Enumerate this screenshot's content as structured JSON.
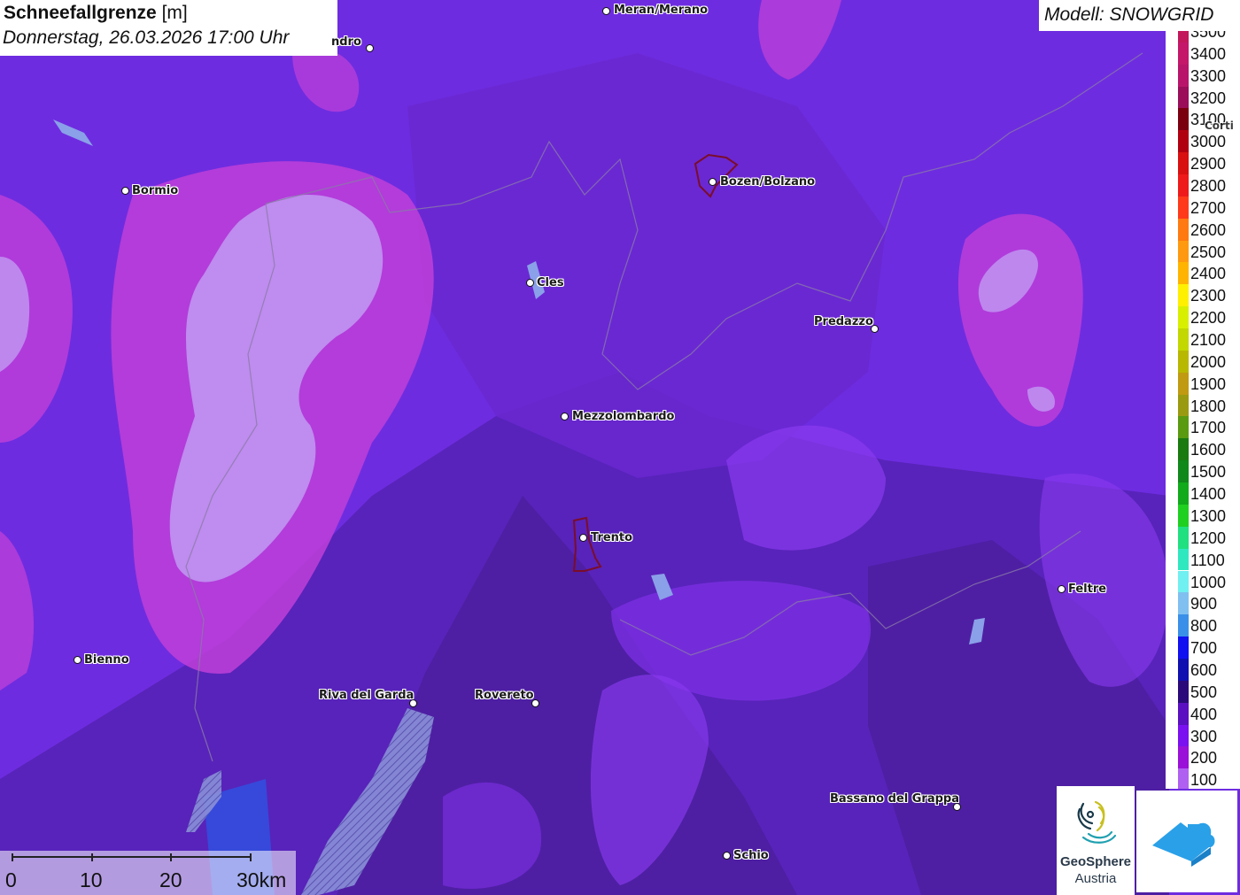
{
  "header": {
    "title_bold": "Schneefallgrenze",
    "title_unit": "[m]",
    "datetime": "Donnerstag, 26.03.2026 17:00 Uhr"
  },
  "model": {
    "label": "Modell: SNOWGRID"
  },
  "legend": {
    "items": [
      {
        "value": "3500",
        "color": "#c2185b"
      },
      {
        "value": "3400",
        "color": "#c4176a"
      },
      {
        "value": "3300",
        "color": "#b8156a"
      },
      {
        "value": "3200",
        "color": "#9a0e5a"
      },
      {
        "value": "3100",
        "color": "#7a0010"
      },
      {
        "value": "3000",
        "color": "#b00010"
      },
      {
        "value": "2900",
        "color": "#d81010"
      },
      {
        "value": "2800",
        "color": "#ee1a1a"
      },
      {
        "value": "2700",
        "color": "#ff3a1a"
      },
      {
        "value": "2600",
        "color": "#ff7a10"
      },
      {
        "value": "2500",
        "color": "#ff9a10"
      },
      {
        "value": "2400",
        "color": "#ffb400"
      },
      {
        "value": "2300",
        "color": "#fff000"
      },
      {
        "value": "2200",
        "color": "#d8f000"
      },
      {
        "value": "2100",
        "color": "#c2d800"
      },
      {
        "value": "2000",
        "color": "#b8b800"
      },
      {
        "value": "1900",
        "color": "#c09a10"
      },
      {
        "value": "1800",
        "color": "#9a9a10"
      },
      {
        "value": "1700",
        "color": "#5a9a10"
      },
      {
        "value": "1600",
        "color": "#1a7a10"
      },
      {
        "value": "1500",
        "color": "#10881a"
      },
      {
        "value": "1400",
        "color": "#10aa1a"
      },
      {
        "value": "1300",
        "color": "#20d020"
      },
      {
        "value": "1200",
        "color": "#20e080"
      },
      {
        "value": "1100",
        "color": "#30e8c0"
      },
      {
        "value": "1000",
        "color": "#70f0f0"
      },
      {
        "value": "900",
        "color": "#80c0f0"
      },
      {
        "value": "800",
        "color": "#3a90e8"
      },
      {
        "value": "700",
        "color": "#1010f0"
      },
      {
        "value": "600",
        "color": "#1010b0"
      },
      {
        "value": "500",
        "color": "#2a0a7a"
      },
      {
        "value": "400",
        "color": "#5a10c0"
      },
      {
        "value": "300",
        "color": "#7a10f0"
      },
      {
        "value": "200",
        "color": "#9a10d8"
      },
      {
        "value": "100",
        "color": "#b060f0"
      }
    ]
  },
  "cities": [
    {
      "name": "Meran/Merano",
      "side": "right"
    },
    {
      "name": "ndro",
      "side": "left"
    },
    {
      "name": "Bormio",
      "side": "right"
    },
    {
      "name": "Bozen/Bolzano",
      "side": "right"
    },
    {
      "name": "Cles",
      "side": "right"
    },
    {
      "name": "Predazzo",
      "side": "left"
    },
    {
      "name": "Mezzolombardo",
      "side": "right"
    },
    {
      "name": "Trento",
      "side": "right"
    },
    {
      "name": "Feltre",
      "side": "right"
    },
    {
      "name": "Bienno",
      "side": "right"
    },
    {
      "name": "Riva del Garda",
      "side": "left"
    },
    {
      "name": "Rovereto",
      "side": "left"
    },
    {
      "name": "Bassano del Grappa",
      "side": "left"
    },
    {
      "name": "Schio",
      "side": "right"
    },
    {
      "name": "Corti",
      "side": "right"
    }
  ],
  "scalebar": {
    "labels": [
      "0",
      "10",
      "20",
      "30km"
    ]
  },
  "logos": {
    "geosphere_name": "GeoSphere",
    "geosphere_sub": "Austria"
  },
  "colors": {
    "base": "#6a2ad6",
    "dark_valley": "#4a1e9a",
    "light_high": "#b070e8",
    "pink_band": "#c040d8"
  }
}
